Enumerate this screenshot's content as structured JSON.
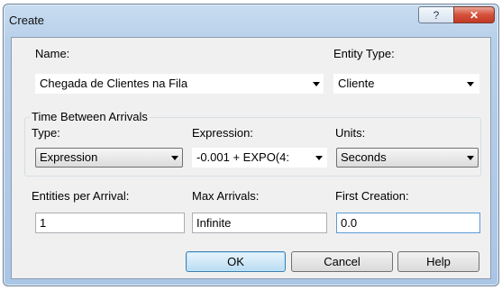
{
  "window": {
    "title": "Create",
    "help_glyph": "?",
    "close_glyph": "✕"
  },
  "fields": {
    "name": {
      "label": "Name:",
      "value": "Chegada de Clientes na Fila"
    },
    "entity_type": {
      "label": "Entity Type:",
      "value": "Cliente"
    },
    "time_between_arrivals": {
      "legend": "Time Between Arrivals",
      "type": {
        "label": "Type:",
        "value": "Expression"
      },
      "expression": {
        "label": "Expression:",
        "value": "-0.001 + EXPO(4:"
      },
      "units": {
        "label": "Units:",
        "value": "Seconds"
      }
    },
    "entities_per_arrival": {
      "label": "Entities per Arrival:",
      "value": "1"
    },
    "max_arrivals": {
      "label": "Max Arrivals:",
      "value": "Infinite"
    },
    "first_creation": {
      "label": "First Creation:",
      "value": "0.0"
    }
  },
  "buttons": {
    "ok": "OK",
    "cancel": "Cancel",
    "help": "Help"
  }
}
